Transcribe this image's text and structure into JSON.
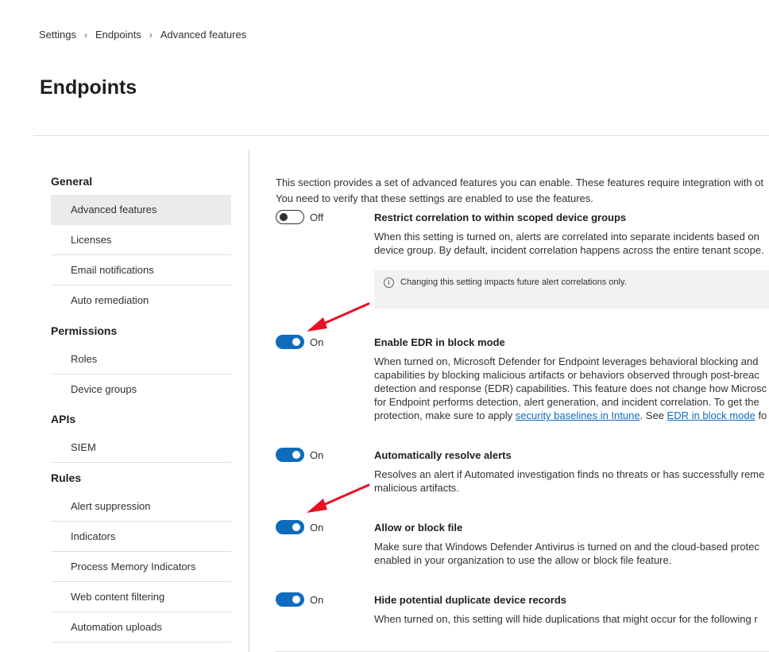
{
  "breadcrumb": {
    "items": [
      "Settings",
      "Endpoints",
      "Advanced features"
    ]
  },
  "page": {
    "title": "Endpoints"
  },
  "nav": {
    "general": "General",
    "general_items": [
      "Advanced features",
      "Licenses",
      "Email notifications",
      "Auto remediation"
    ],
    "permissions": "Permissions",
    "permissions_items": [
      "Roles",
      "Device groups"
    ],
    "apis": "APIs",
    "apis_items": [
      "SIEM"
    ],
    "rules": "Rules",
    "rules_items": [
      "Alert suppression",
      "Indicators",
      "Process Memory Indicators",
      "Web content filtering",
      "Automation uploads"
    ],
    "selected": "Advanced features"
  },
  "intro": {
    "line1": "This section provides a set of advanced features you can enable. These features require integration with ot",
    "line2": "You need to verify that these settings are enabled to use the features."
  },
  "settings": [
    {
      "state": "Off",
      "title": "Restrict correlation to within scoped device groups",
      "desc": [
        "When this setting is turned on, alerts are correlated into separate incidents based on",
        "device group. By default, incident correlation happens across the entire tenant scope."
      ],
      "info": "Changing this setting impacts future alert correlations only."
    },
    {
      "state": "On",
      "title": "Enable EDR in block mode",
      "desc": [
        "When turned on, Microsoft Defender for Endpoint leverages behavioral blocking and",
        "capabilities by blocking malicious artifacts or behaviors observed through post-breac",
        "detection and response (EDR) capabilities. This feature does not change how Microsc",
        "for Endpoint performs detection, alert generation, and incident correlation. To get the"
      ],
      "desc_last_prefix": "protection, make sure to apply ",
      "link1": "security baselines in Intune",
      "desc_last_mid": ". See ",
      "link2": "EDR in block mode",
      "desc_last_suffix": " fo"
    },
    {
      "state": "On",
      "title": "Automatically resolve alerts",
      "desc": [
        "Resolves an alert if Automated investigation finds no threats or has successfully reme",
        "malicious artifacts."
      ]
    },
    {
      "state": "On",
      "title": "Allow or block file",
      "desc": [
        "Make sure that Windows Defender Antivirus is turned on and the cloud-based protec",
        "enabled in your organization to use the allow or block file feature."
      ]
    },
    {
      "state": "On",
      "title": "Hide potential duplicate device records",
      "desc": [
        "When turned on, this setting will hide duplications that might occur for the following r"
      ]
    }
  ],
  "colors": {
    "accent": "#0f6cbd",
    "arrow": "#e81123",
    "selected_bg": "#edebe9"
  },
  "icons": {
    "separator": "chevron-right-icon",
    "info": "info-icon"
  }
}
